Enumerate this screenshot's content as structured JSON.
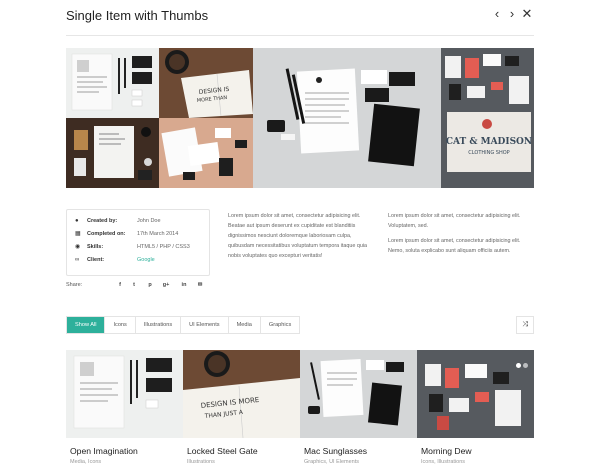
{
  "header": {
    "title": "Single Item with Thumbs",
    "prev_icon": "‹",
    "next_icon": "›",
    "close_icon": "✕"
  },
  "gallery": {
    "thumbs": [
      {
        "name": "gallery-thumb-resume",
        "color": "#eef0ef"
      },
      {
        "name": "gallery-thumb-sketchbook",
        "color": "#6d4a34"
      },
      {
        "name": "gallery-thumb-wood-stationery",
        "color": "#3e2c22"
      },
      {
        "name": "gallery-thumb-pink-stationery",
        "color": "#d8a98f"
      },
      {
        "name": "gallery-main-image",
        "color": "#d4d6d7"
      },
      {
        "name": "gallery-thumb-clothing-shop",
        "color": "#565a5f"
      }
    ],
    "logo_text": "CAT & MADISON",
    "logo_sub": "CLOTHING SHOP",
    "sketch_text": "DESIGN IS MORE THAN JUST A PROFESSION"
  },
  "meta": {
    "created_by": {
      "label": "Created by:",
      "value": "John Doe"
    },
    "completed_on": {
      "label": "Completed on:",
      "value": "17th March 2014"
    },
    "skills": {
      "label": "Skills:",
      "value": "HTML5 / PHP / CSS3"
    },
    "client": {
      "label": "Client:",
      "value": "Google"
    }
  },
  "share": {
    "label": "Share:",
    "icons": [
      "f",
      "t",
      "p",
      "g+",
      "in",
      "✉"
    ]
  },
  "description": {
    "col1": "Lorem ipsum dolor sit amet, consectetur adipisicing elit. Beatae aut ipsum deserunt ex cupiditate est blanditiis dignissimos nesciunt doloremque laboriosam culpa, quibusdam necessitatibus voluptatum tempora itaque quia nobis voluptates quo excepturi veritatis!",
    "col2_p1": "Lorem ipsum dolor sit amet, consectetur adipisicing elit. Voluptatem, sed.",
    "col2_p2": "Lorem ipsum dolor sit amet, consectetur adipisicing elit. Nemo, soluta explicabo sunt aliquam officiis autem."
  },
  "filters": {
    "items": [
      "Show All",
      "Icons",
      "Illustrations",
      "UI Elements",
      "Media",
      "Graphics"
    ],
    "active": "Show All",
    "shuffle_icon": "⤨"
  },
  "cards": [
    {
      "title": "Open Imagination",
      "category": "Media, Icons",
      "color": "#eef0ef"
    },
    {
      "title": "Locked Steel Gate",
      "category": "Illustrations",
      "color": "#efe9e1"
    },
    {
      "title": "Mac Sunglasses",
      "category": "Graphics, UI Elements",
      "color": "#d4d6d7"
    },
    {
      "title": "Morning Dew",
      "category": "Icons, Illustrations",
      "color": "#565a5f"
    }
  ]
}
